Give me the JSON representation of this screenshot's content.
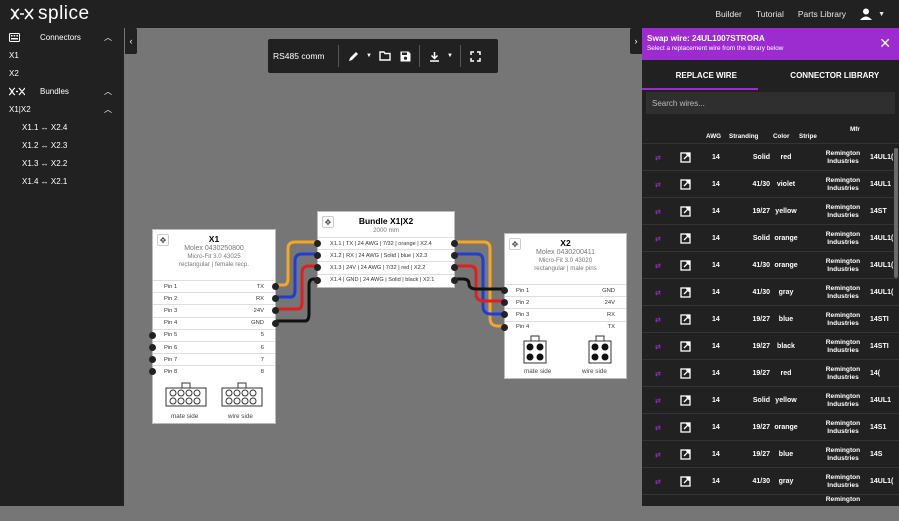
{
  "app": {
    "logo_text": "splice",
    "nav": [
      "Builder",
      "Tutorial",
      "Parts Library"
    ]
  },
  "sidebar": {
    "connectors_label": "Connectors",
    "connectors": [
      "X1",
      "X2"
    ],
    "bundles_label": "Bundles",
    "bundle": "X1|X2",
    "mappings": [
      "X1.1 ↔ X2.4",
      "X1.2 ↔ X2.3",
      "X1.3 ↔ X2.2",
      "X1.4 ↔ X2.1"
    ]
  },
  "toolbar": {
    "project": "RS485 comm"
  },
  "x1": {
    "title": "X1",
    "part": "Molex 0430250800",
    "series": "Micro-Fit 3.0 43025",
    "desc": "rectangular | female recp.",
    "pins": [
      [
        "Pin 1",
        "TX"
      ],
      [
        "Pin 2",
        "RX"
      ],
      [
        "Pin 3",
        "24V"
      ],
      [
        "Pin 4",
        "GND"
      ],
      [
        "Pin 5",
        "5"
      ],
      [
        "Pin 6",
        "6"
      ],
      [
        "Pin 7",
        "7"
      ],
      [
        "Pin 8",
        "8"
      ]
    ],
    "mate": "mate side",
    "wire": "wire side"
  },
  "bundle": {
    "title": "Bundle X1|X2",
    "length": "2000 mm",
    "wires": [
      "X1.1 | TX | 24 AWG | 7/32 | orange | X2.4",
      "X1.2 | RX | 24 AWG | Solid | blue | X2.3",
      "X1.3 | 24V | 24 AWG | 7/32 | red | X2.2",
      "X1.4 | GND | 24 AWG | Solid | black | X2.1"
    ]
  },
  "x2": {
    "title": "X2",
    "part": "Molex 0430200411",
    "series": "Micro-Fit 3.0 43020",
    "desc": "rectangular | male pins",
    "pins": [
      [
        "Pin 1",
        "GND"
      ],
      [
        "Pin 2",
        "24V"
      ],
      [
        "Pin 3",
        "RX"
      ],
      [
        "Pin 4",
        "TX"
      ]
    ],
    "mate": "mate side",
    "wire": "wire side"
  },
  "panel": {
    "title": "Swap wire: 24UL1007STRORA",
    "subtitle": "Select a replacement wire from the library below",
    "tabs": [
      "REPLACE WIRE",
      "CONNECTOR LIBRARY"
    ],
    "search_placeholder": "Search wires...",
    "headers": [
      "AWG",
      "Stranding",
      "Color",
      "Stripe",
      "Mfr"
    ],
    "rows": [
      [
        "14",
        "Solid",
        "red",
        "Remington Industries",
        "14UL1("
      ],
      [
        "14",
        "41/30",
        "violet",
        "Remington Industries",
        "14UL1"
      ],
      [
        "14",
        "19/27",
        "yellow",
        "Remington Industries",
        "14ST"
      ],
      [
        "14",
        "Solid",
        "orange",
        "Remington Industries",
        "14UL1("
      ],
      [
        "14",
        "41/30",
        "orange",
        "Remington Industries",
        "14UL1("
      ],
      [
        "14",
        "41/30",
        "gray",
        "Remington Industries",
        "14UL1("
      ],
      [
        "14",
        "19/27",
        "blue",
        "Remington Industries",
        "14STI"
      ],
      [
        "14",
        "19/27",
        "black",
        "Remington Industries",
        "14STI"
      ],
      [
        "14",
        "19/27",
        "red",
        "Remington Industries",
        "14("
      ],
      [
        "14",
        "Solid",
        "yellow",
        "Remington Industries",
        "14UL1"
      ],
      [
        "14",
        "19/27",
        "orange",
        "Remington Industries",
        "14S1"
      ],
      [
        "14",
        "19/27",
        "blue",
        "Remington Industries",
        "14S"
      ],
      [
        "14",
        "41/30",
        "gray",
        "Remington Industries",
        "14UL1("
      ]
    ],
    "partial_row_mfr": "Remington"
  },
  "colors": {
    "accent": "#9c2bd0",
    "orange": "#f5a623",
    "blue": "#1f3dd8",
    "red": "#e02020",
    "black": "#111111"
  }
}
